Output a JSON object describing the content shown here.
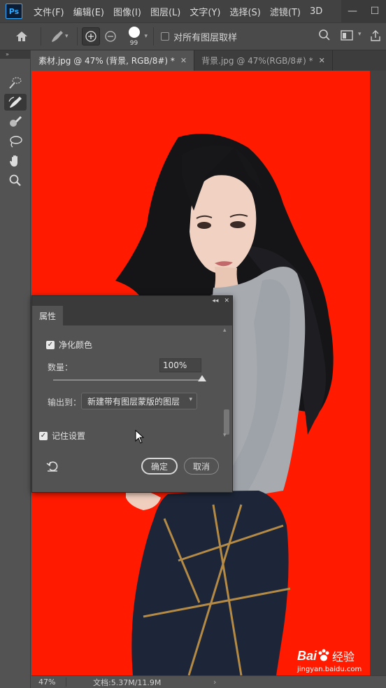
{
  "app": {
    "logo": "Ps"
  },
  "menu": [
    "文件(F)",
    "编辑(E)",
    "图像(I)",
    "图层(L)",
    "文字(Y)",
    "选择(S)",
    "滤镜(T)",
    "3D"
  ],
  "window_controls": [
    "minimize-icon",
    "maximize-icon"
  ],
  "options_bar": {
    "brush_size": "99",
    "sample_all_layers_label": "对所有图层取样",
    "sample_all_layers_checked": false
  },
  "tools": [
    {
      "name": "quick-selection-tool-icon",
      "active": false
    },
    {
      "name": "refine-edge-brush-icon",
      "active": true
    },
    {
      "name": "brush-tool-icon",
      "active": false
    },
    {
      "name": "lasso-tool-icon",
      "active": false
    },
    {
      "name": "hand-tool-icon",
      "active": false
    },
    {
      "name": "zoom-tool-icon",
      "active": false
    }
  ],
  "tabs": [
    {
      "label": "素材.jpg @ 47% (背景, RGB/8#) *",
      "active": true
    },
    {
      "label": "背景.jpg @ 47%(RGB/8#) *",
      "active": false
    }
  ],
  "canvas": {
    "background": "#ff1a00"
  },
  "properties_panel": {
    "tab_label": "属性",
    "decontaminate_label": "净化颜色",
    "decontaminate_checked": true,
    "amount_label": "数量：",
    "amount_value": "100%",
    "output_label": "输出到：",
    "output_value": "新建带有图层蒙版的图层",
    "remember_label": "记住设置",
    "remember_checked": true,
    "ok_label": "确定",
    "cancel_label": "取消"
  },
  "status": {
    "zoom": "47%",
    "doc": "文档:5.37M/11.9M"
  },
  "watermark": {
    "brand": "Bai",
    "brand2": "经验",
    "url": "jingyan.baidu.com"
  }
}
